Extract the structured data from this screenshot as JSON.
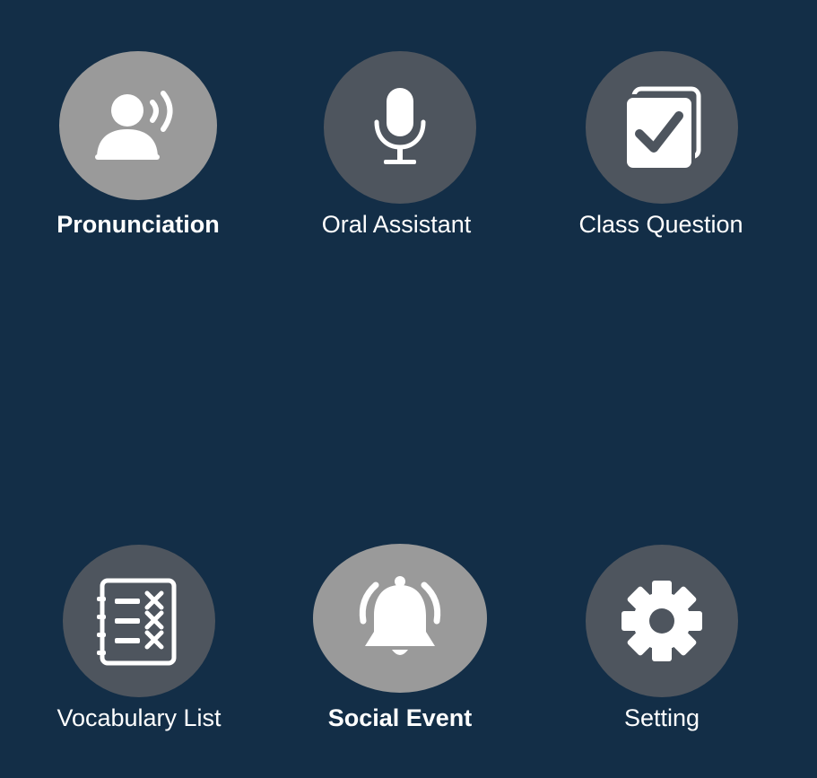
{
  "colors": {
    "background": "#132e47",
    "circle_default": "#4e555e",
    "circle_active": "#9a9a9a",
    "icon": "#ffffff",
    "label": "#ffffff"
  },
  "menu": {
    "items": [
      {
        "label": "Pronunciation",
        "icon": "speaking-person-icon",
        "active": true
      },
      {
        "label": "Oral Assistant",
        "icon": "microphone-icon",
        "active": false
      },
      {
        "label": "Class Question",
        "icon": "checkbox-cards-icon",
        "active": false
      },
      {
        "label": "Vocabulary List",
        "icon": "vocabulary-list-icon",
        "active": false
      },
      {
        "label": "Social Event",
        "icon": "bell-icon",
        "active": true
      },
      {
        "label": "Setting",
        "icon": "gear-icon",
        "active": false
      }
    ]
  }
}
